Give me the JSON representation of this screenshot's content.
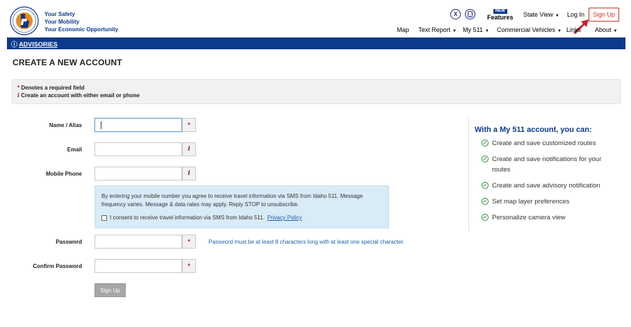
{
  "header": {
    "tagline": [
      "Your Safety",
      "Your Mobility",
      "Your Economic Opportunity"
    ],
    "features_badge": "NEW",
    "features_label": "Features",
    "state_view": "State View",
    "login": "Log In",
    "signup": "Sign Up",
    "x_icon": "x-social-icon",
    "phone_icon": "phone-icon"
  },
  "nav": {
    "map": "Map",
    "text_report": "Text Report",
    "my511": "My 511",
    "commercial": "Commercial Vehicles",
    "links": "Links",
    "about": "About"
  },
  "advisories": {
    "icon": "ⓘ",
    "label": "ADVISORIES"
  },
  "page": {
    "title": "CREATE A NEW ACCOUNT"
  },
  "notes": {
    "required": "Denotes a required field",
    "either": "Create an account with either email or phone"
  },
  "form": {
    "name_label": "Name / Alias",
    "email_label": "Email",
    "phone_label": "Mobile Phone",
    "password_label": "Password",
    "confirm_label": "Confirm Password",
    "sms_text": "By entering your mobile number you agree to receive travel information via SMS from Idaho 511. Message frequency varies. Message & data rates may apply. Reply STOP to unsubscribe.",
    "consent_text": "I consent to receive travel information via SMS from Idaho 511.",
    "privacy_link": "Privacy Policy",
    "password_hint": "Password must be at least 8 characters long with at least one special character.",
    "submit": "Sign Up"
  },
  "benefits": {
    "title": "With a My 511 account, you can:",
    "items": [
      "Create and save customized routes",
      "Create and save notifications for your routes",
      "Create and save advisory notification",
      "Set map layer preferences",
      "Personalize camera view"
    ]
  },
  "colors": {
    "brand": "#0b3a8c",
    "signup_border": "#c0392b",
    "check": "#2e8a3a",
    "sms_bg": "#d8ebf6"
  }
}
